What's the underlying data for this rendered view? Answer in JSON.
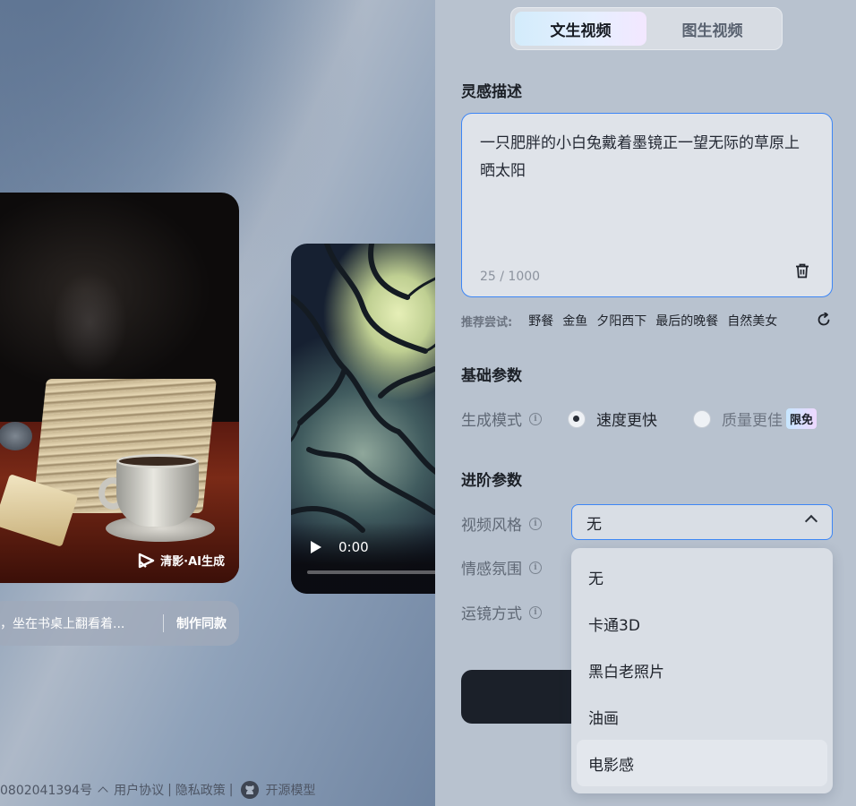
{
  "gallery": {
    "watermark": "清影·AI生成",
    "caption_text": "，坐在书桌上翻看着...",
    "make_same": "制作同款",
    "video_time": "0:00"
  },
  "footer": {
    "icp": "0802041394号",
    "user_agreement": "用户协议",
    "privacy": "隐私政策",
    "separator": "|",
    "open_source": "开源模型"
  },
  "tabs": [
    {
      "label": "文生视频",
      "active": true
    },
    {
      "label": "图生视频",
      "active": false
    }
  ],
  "prompt": {
    "section_title": "灵感描述",
    "text": "一只肥胖的小白兔戴着墨镜正一望无际的草原上晒太阳",
    "counter": "25 / 1000"
  },
  "suggestions": {
    "label": "推荐尝试:",
    "items": [
      "野餐",
      "金鱼",
      "夕阳西下",
      "最后的晚餐",
      "自然美女"
    ]
  },
  "basic": {
    "section_title": "基础参数",
    "mode_label": "生成模式",
    "options": [
      {
        "label": "速度更快",
        "selected": true
      },
      {
        "label": "质量更佳",
        "selected": false
      }
    ],
    "badge": "限免"
  },
  "advanced": {
    "section_title": "进阶参数",
    "style_label": "视频风格",
    "style_value": "无",
    "mood_label": "情感氛围",
    "camera_label": "运镜方式"
  },
  "dropdown": {
    "items": [
      "无",
      "卡通3D",
      "黑白老照片",
      "油画",
      "电影感"
    ],
    "hovered_index": 4
  },
  "colors": {
    "accent": "#3d86f5",
    "panel_bg": "#b8c2cf",
    "button_dark": "#1b2029"
  }
}
